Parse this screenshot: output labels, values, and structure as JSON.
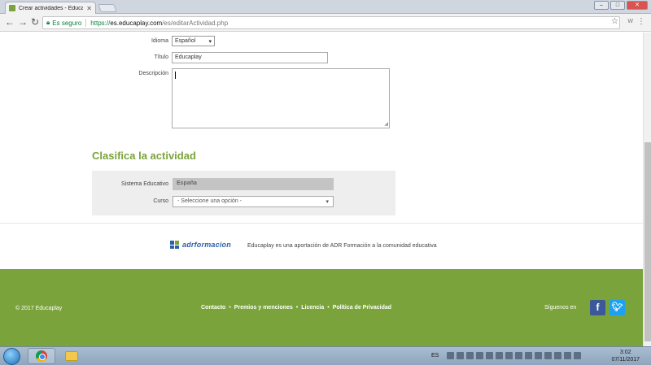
{
  "browser": {
    "tab_title": "Crear actividades - Educa",
    "secure_label": "Es seguro",
    "url_scheme": "https://",
    "url_host": "es.educaplay.com",
    "url_path": "/es/editarActividad.php"
  },
  "form": {
    "language_label": "Idioma",
    "language_value": "Español",
    "title_label": "Título",
    "title_value": "Educaplay",
    "description_label": "Descripción"
  },
  "classify": {
    "heading": "Clasifica la actividad",
    "system_label": "Sistema Educativo",
    "system_value": "España",
    "course_label": "Curso",
    "course_placeholder": "- Seleccione una opción -"
  },
  "partner": {
    "logo_text": "adrformacion",
    "caption": "Educaplay es una aportación de ADR Formación a la comunidad educativa"
  },
  "footer": {
    "copyright": "© 2017 Educaplay",
    "links": [
      "Contacto",
      "Premios y menciones",
      "Licencia",
      "Política de Privacidad"
    ],
    "separator": "•",
    "follow_label": "Síguenos en"
  },
  "taskbar": {
    "language": "ES",
    "time": "3:02",
    "date": "07/11/2017"
  },
  "colors": {
    "brand_green": "#7aa33b",
    "facebook": "#3b5998",
    "twitter": "#1da1f2"
  }
}
